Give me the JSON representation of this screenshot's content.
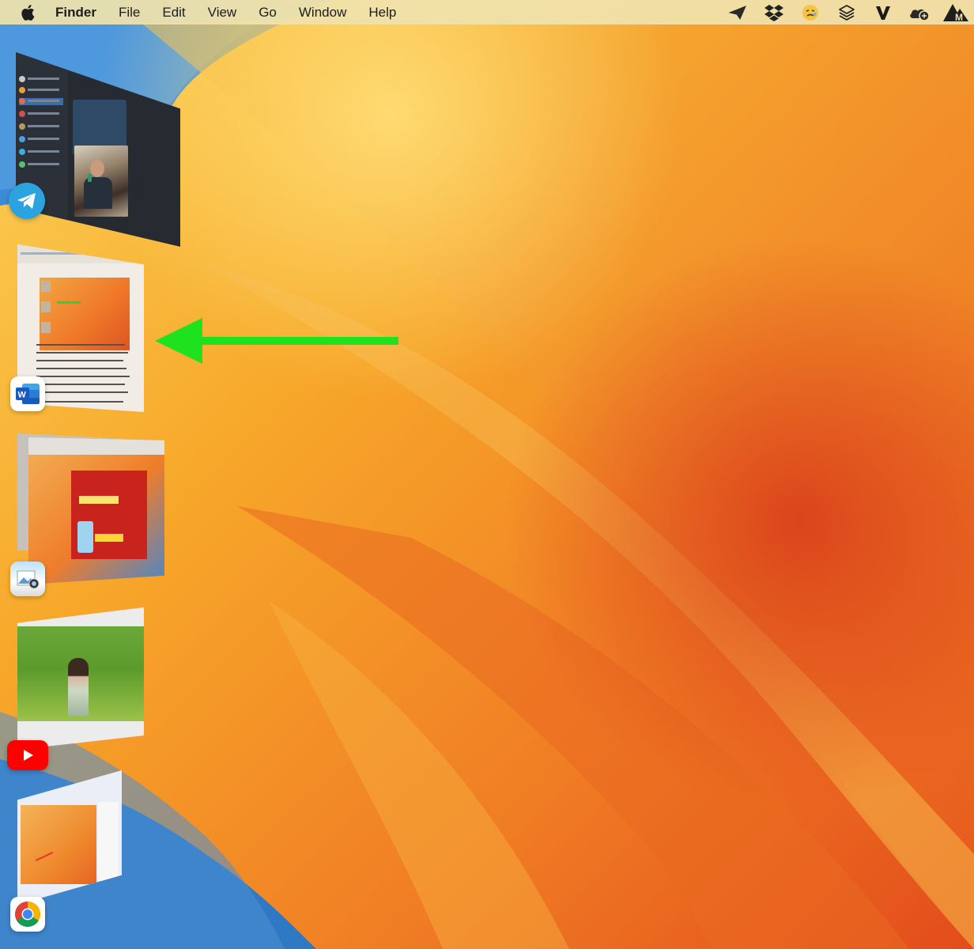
{
  "menubar": {
    "apple_icon": "apple-logo-icon",
    "app_name": "Finder",
    "items": [
      "File",
      "Edit",
      "View",
      "Go",
      "Window",
      "Help"
    ],
    "status_icons": [
      "telegram-send-icon",
      "dropbox-icon",
      "emoji-face-icon",
      "layers-icon",
      "v-icon",
      "cloud-weather-icon",
      "m-icon"
    ]
  },
  "stage_manager": {
    "windows": [
      {
        "app": "Telegram",
        "icon": "telegram-icon",
        "accent": "#2aa3df"
      },
      {
        "app": "Microsoft Word",
        "icon": "word-icon",
        "accent": "#1f5fbf"
      },
      {
        "app": "Preview",
        "icon": "preview-icon",
        "accent": "#5b9bd5"
      },
      {
        "app": "YouTube",
        "icon": "youtube-icon",
        "accent": "#ff0000"
      },
      {
        "app": "Google Chrome",
        "icon": "chrome-icon",
        "accent": "#34a853"
      }
    ]
  },
  "annotation": {
    "type": "arrow",
    "color": "#1ee21e",
    "direction": "left"
  },
  "wallpaper": {
    "name": "macOS Ventura",
    "colors": [
      "#f7c13f",
      "#f08a26",
      "#e0501d",
      "#3f80c8"
    ]
  }
}
